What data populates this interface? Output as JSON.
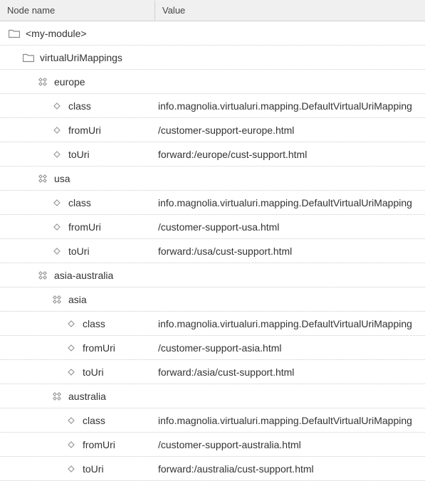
{
  "header": {
    "name_col": "Node name",
    "value_col": "Value"
  },
  "rows": [
    {
      "indent": 0,
      "icon": "folder",
      "name": "<my-module>",
      "value": ""
    },
    {
      "indent": 1,
      "icon": "folder",
      "name": "virtualUriMappings",
      "value": ""
    },
    {
      "indent": 2,
      "icon": "content",
      "name": "europe",
      "value": ""
    },
    {
      "indent": 3,
      "icon": "prop",
      "name": "class",
      "value": "info.magnolia.virtualuri.mapping.DefaultVirtualUriMapping"
    },
    {
      "indent": 3,
      "icon": "prop",
      "name": "fromUri",
      "value": "/customer-support-europe.html"
    },
    {
      "indent": 3,
      "icon": "prop",
      "name": "toUri",
      "value": "forward:/europe/cust-support.html"
    },
    {
      "indent": 2,
      "icon": "content",
      "name": "usa",
      "value": ""
    },
    {
      "indent": 3,
      "icon": "prop",
      "name": "class",
      "value": "info.magnolia.virtualuri.mapping.DefaultVirtualUriMapping"
    },
    {
      "indent": 3,
      "icon": "prop",
      "name": "fromUri",
      "value": "/customer-support-usa.html"
    },
    {
      "indent": 3,
      "icon": "prop",
      "name": "toUri",
      "value": "forward:/usa/cust-support.html"
    },
    {
      "indent": 2,
      "icon": "content",
      "name": "asia-australia",
      "value": ""
    },
    {
      "indent": 3,
      "icon": "content",
      "name": "asia",
      "value": ""
    },
    {
      "indent": 4,
      "icon": "prop",
      "name": "class",
      "value": "info.magnolia.virtualuri.mapping.DefaultVirtualUriMapping"
    },
    {
      "indent": 4,
      "icon": "prop",
      "name": "fromUri",
      "value": "/customer-support-asia.html"
    },
    {
      "indent": 4,
      "icon": "prop",
      "name": "toUri",
      "value": "forward:/asia/cust-support.html"
    },
    {
      "indent": 3,
      "icon": "content",
      "name": "australia",
      "value": ""
    },
    {
      "indent": 4,
      "icon": "prop",
      "name": "class",
      "value": "info.magnolia.virtualuri.mapping.DefaultVirtualUriMapping"
    },
    {
      "indent": 4,
      "icon": "prop",
      "name": "fromUri",
      "value": "/customer-support-australia.html"
    },
    {
      "indent": 4,
      "icon": "prop",
      "name": "toUri",
      "value": "forward:/australia/cust-support.html"
    }
  ]
}
